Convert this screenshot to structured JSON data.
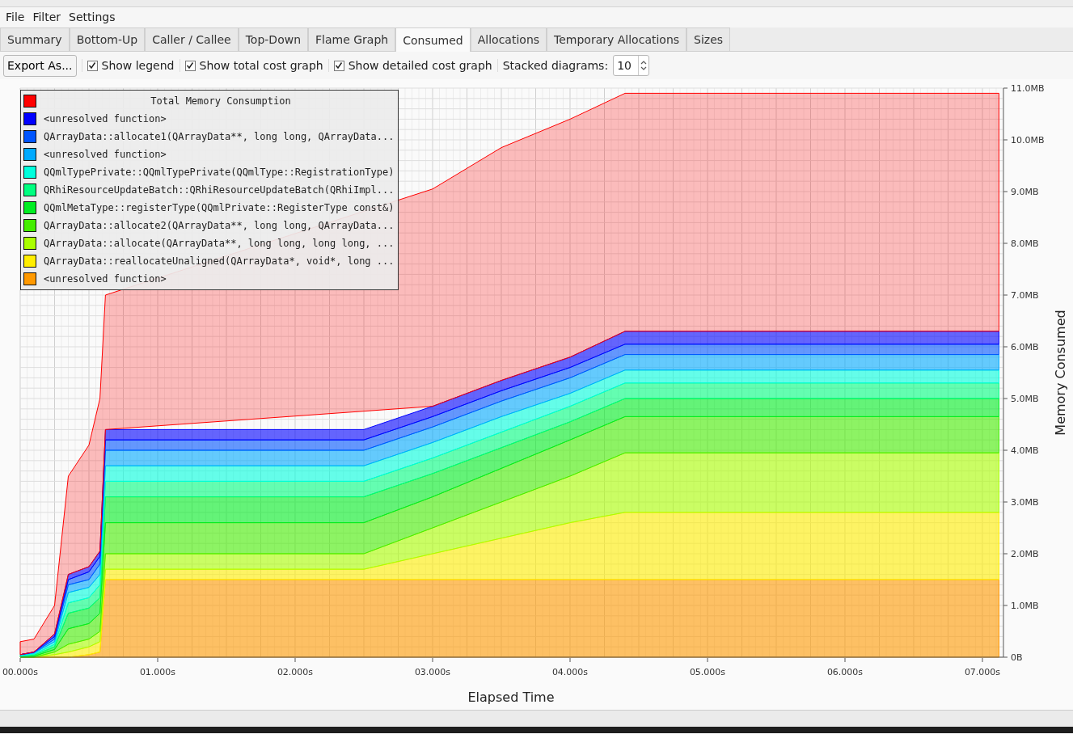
{
  "menu": [
    {
      "label": "File"
    },
    {
      "label": "Filter"
    },
    {
      "label": "Settings"
    }
  ],
  "tabs": [
    {
      "label": "Summary",
      "selected": false
    },
    {
      "label": "Bottom-Up",
      "selected": false
    },
    {
      "label": "Caller / Callee",
      "selected": false
    },
    {
      "label": "Top-Down",
      "selected": false
    },
    {
      "label": "Flame Graph",
      "selected": false
    },
    {
      "label": "Consumed",
      "selected": true
    },
    {
      "label": "Allocations",
      "selected": false
    },
    {
      "label": "Temporary Allocations",
      "selected": false
    },
    {
      "label": "Sizes",
      "selected": false
    }
  ],
  "toolbar": {
    "export_button": "Export As...",
    "checkboxes": [
      {
        "label": "Show legend",
        "checked": true
      },
      {
        "label": "Show total cost graph",
        "checked": true
      },
      {
        "label": "Show detailed cost graph",
        "checked": true
      }
    ],
    "stacked_label": "Stacked diagrams:",
    "stacked_value": "10"
  },
  "chart": {
    "chart_data": {
      "type": "area",
      "xlabel": "Elapsed Time",
      "ylabel": "Memory Consumed",
      "stacked": true,
      "grid": true,
      "x": [
        0,
        0.1,
        0.25,
        0.35,
        0.5,
        0.58,
        0.62,
        2.5,
        3.0,
        3.5,
        4.0,
        4.4,
        7.12
      ],
      "xlim": [
        0,
        7.147
      ],
      "ylim": [
        0,
        11
      ],
      "xticks": [
        {
          "value": 0,
          "label": "00.000s"
        },
        {
          "value": 1,
          "label": "01.000s"
        },
        {
          "value": 2,
          "label": "02.000s"
        },
        {
          "value": 3,
          "label": "03.000s"
        },
        {
          "value": 4,
          "label": "04.000s"
        },
        {
          "value": 5,
          "label": "05.000s"
        },
        {
          "value": 6,
          "label": "06.000s"
        },
        {
          "value": 7,
          "label": "07.000s"
        }
      ],
      "yticks": [
        {
          "value": 0,
          "label": "0B"
        },
        {
          "value": 1,
          "label": "1.0MB"
        },
        {
          "value": 2,
          "label": "2.0MB"
        },
        {
          "value": 3,
          "label": "3.0MB"
        },
        {
          "value": 4,
          "label": "4.0MB"
        },
        {
          "value": 5,
          "label": "5.0MB"
        },
        {
          "value": 6,
          "label": "6.0MB"
        },
        {
          "value": 7,
          "label": "7.0MB"
        },
        {
          "value": 8,
          "label": "8.0MB"
        },
        {
          "value": 9,
          "label": "9.0MB"
        },
        {
          "value": 10,
          "label": "10.0MB"
        },
        {
          "value": 11,
          "label": "11.0MB"
        }
      ],
      "series": [
        {
          "name": "<unresolved function>",
          "color": "#ff9900",
          "values": [
            0,
            0,
            0,
            0,
            0.05,
            0.1,
            1.5,
            1.5,
            1.5,
            1.5,
            1.5,
            1.5,
            1.5
          ]
        },
        {
          "name": "QArrayData::reallocateUnaligned(QArrayData*, void*, long ...",
          "color": "#ffee00",
          "values": [
            0,
            0,
            0.05,
            0.1,
            0.15,
            0.2,
            0.2,
            0.2,
            0.5,
            0.8,
            1.1,
            1.3,
            1.3
          ]
        },
        {
          "name": "QArrayData::allocate(QArrayData**, long long, long long, ...",
          "color": "#aaff00",
          "values": [
            0,
            0,
            0.05,
            0.15,
            0.15,
            0.2,
            0.3,
            0.3,
            0.5,
            0.7,
            0.9,
            1.15,
            1.15
          ]
        },
        {
          "name": "QArrayData::allocate2(QArrayData**, long long, QArrayData...",
          "color": "#44ee00",
          "values": [
            0.01,
            0.02,
            0.05,
            0.3,
            0.3,
            0.35,
            0.6,
            0.6,
            0.6,
            0.65,
            0.7,
            0.7,
            0.7
          ]
        },
        {
          "name": "QQmlMetaType::registerType(QQmlPrivate::RegisterType const&)",
          "color": "#00ee22",
          "values": [
            0.01,
            0.02,
            0.05,
            0.3,
            0.3,
            0.3,
            0.5,
            0.5,
            0.45,
            0.4,
            0.35,
            0.35,
            0.35
          ]
        },
        {
          "name": "QRhiResourceUpdateBatch::QRhiResourceUpdateBatch(QRhiImpl...",
          "color": "#00ff80",
          "values": [
            0.01,
            0.02,
            0.05,
            0.2,
            0.2,
            0.25,
            0.3,
            0.3,
            0.3,
            0.3,
            0.3,
            0.3,
            0.3
          ]
        },
        {
          "name": "QQmlTypePrivate::QQmlTypePrivate(QQmlType::RegistrationType)",
          "color": "#00ffdd",
          "values": [
            0.01,
            0.02,
            0.05,
            0.2,
            0.2,
            0.2,
            0.3,
            0.3,
            0.3,
            0.3,
            0.25,
            0.25,
            0.25
          ]
        },
        {
          "name": "<unresolved function>",
          "color": "#00aaff",
          "values": [
            0.01,
            0.01,
            0.05,
            0.15,
            0.15,
            0.2,
            0.3,
            0.3,
            0.3,
            0.3,
            0.3,
            0.3,
            0.3
          ]
        },
        {
          "name": "QArrayData::allocate1(QArrayData**, long long, QArrayData...",
          "color": "#0055ff",
          "values": [
            0,
            0.01,
            0.05,
            0.1,
            0.15,
            0.15,
            0.2,
            0.2,
            0.2,
            0.2,
            0.2,
            0.2,
            0.2
          ]
        },
        {
          "name": "<unresolved function>",
          "color": "#0000ff",
          "values": [
            0,
            0,
            0.05,
            0.1,
            0.1,
            0.1,
            0.2,
            0.2,
            0.2,
            0.2,
            0.2,
            0.25,
            0.25
          ]
        },
        {
          "name": "Total Memory Consumption",
          "color": "#ff0000",
          "values": [
            0.25,
            0.25,
            0.55,
            1.9,
            2.35,
            2.95,
            2.6,
            null,
            4.2,
            4.5,
            4.6,
            4.6,
            4.6
          ]
        }
      ]
    }
  }
}
